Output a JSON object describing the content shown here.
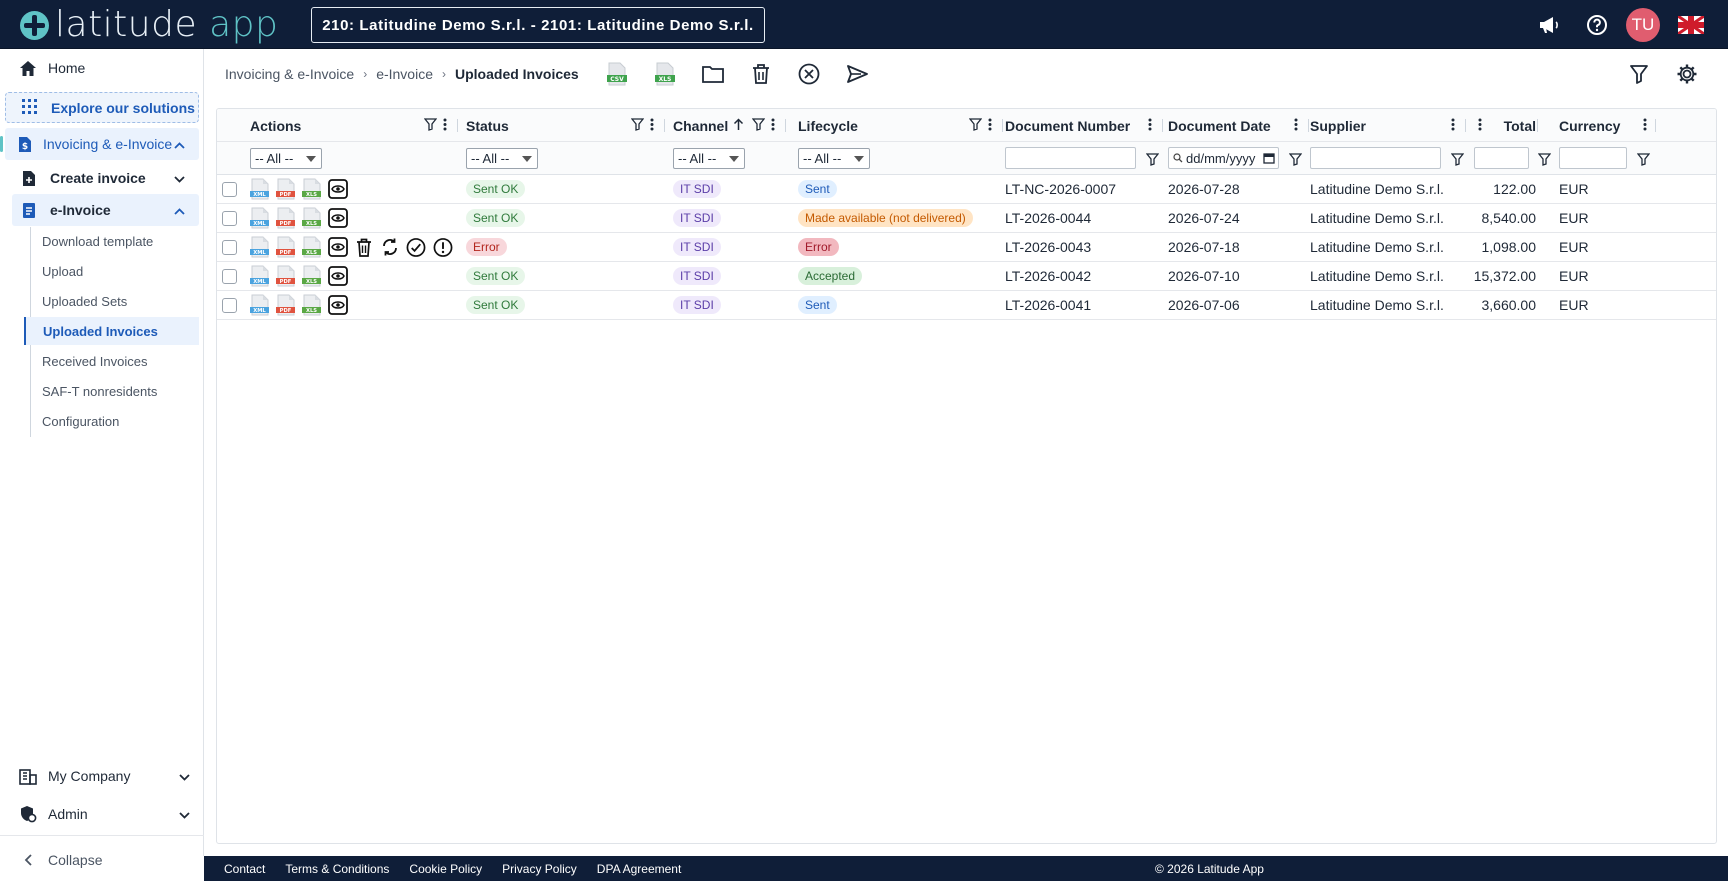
{
  "app": {
    "logo_word": "latitude",
    "logo_app": "app"
  },
  "header": {
    "company_selector": "210: Latitudine Demo S.r.l. - 2101: Latitudine Demo S.r.l.",
    "avatar_initials": "TU",
    "icons": [
      "megaphone-icon",
      "help-icon",
      "avatar",
      "uk-flag-icon"
    ]
  },
  "sidebar": {
    "home": "Home",
    "explore": "Explore our solutions",
    "invoicing": "Invoicing & e-Invoice",
    "create_invoice": "Create invoice",
    "einvoice": "e-Invoice",
    "leaves": [
      "Download template",
      "Upload",
      "Uploaded Sets",
      "Uploaded Invoices",
      "Received Invoices",
      "SAF-T nonresidents",
      "Configuration"
    ],
    "active_leaf": "Uploaded Invoices",
    "my_company": "My Company",
    "admin": "Admin",
    "collapse": "Collapse"
  },
  "breadcrumb": [
    "Invoicing & e-Invoice",
    "e-Invoice",
    "Uploaded Invoices"
  ],
  "toolbar_icons": [
    "csv-export-icon",
    "xls-export-icon",
    "folder-icon",
    "trash-icon",
    "cancel-circle-icon",
    "send-icon",
    "filter-icon",
    "settings-icon"
  ],
  "grid": {
    "columns": [
      "Actions",
      "Status",
      "Channel",
      "Lifecycle",
      "Document Number",
      "Document Date",
      "Supplier",
      "Total",
      "Currency"
    ],
    "filters": {
      "status": "-- All --",
      "channel": "-- All --",
      "lifecycle": "-- All --",
      "actions": "-- All --",
      "date_placeholder": "dd/mm/yyyy"
    },
    "rows": [
      {
        "status": "Sent OK",
        "channel": "IT SDI",
        "lifecycle": "Sent",
        "lifecycle_style": "blue",
        "doc": "LT-NC-2026-0007",
        "date": "2026-07-28",
        "supplier": "Latitudine Demo S.r.l.",
        "total": "122.00",
        "currency": "EUR",
        "extra_actions": false
      },
      {
        "status": "Sent OK",
        "channel": "IT SDI",
        "lifecycle": "Made available (not delivered)",
        "lifecycle_style": "orange",
        "doc": "LT-2026-0044",
        "date": "2026-07-24",
        "supplier": "Latitudine Demo S.r.l.",
        "total": "8,540.00",
        "currency": "EUR",
        "extra_actions": false
      },
      {
        "status": "Error",
        "channel": "IT SDI",
        "lifecycle": "Error",
        "lifecycle_style": "redstrong",
        "doc": "LT-2026-0043",
        "date": "2026-07-18",
        "supplier": "Latitudine Demo S.r.l.",
        "total": "1,098.00",
        "currency": "EUR",
        "extra_actions": true
      },
      {
        "status": "Sent OK",
        "channel": "IT SDI",
        "lifecycle": "Accepted",
        "lifecycle_style": "greenacc",
        "doc": "LT-2026-0042",
        "date": "2026-07-10",
        "supplier": "Latitudine Demo S.r.l.",
        "total": "15,372.00",
        "currency": "EUR",
        "extra_actions": false
      },
      {
        "status": "Sent OK",
        "channel": "IT SDI",
        "lifecycle": "Sent",
        "lifecycle_style": "blue",
        "doc": "LT-2026-0041",
        "date": "2026-07-06",
        "supplier": "Latitudine Demo S.r.l.",
        "total": "3,660.00",
        "currency": "EUR",
        "extra_actions": false
      }
    ]
  },
  "footer": {
    "links": [
      "Contact",
      "Terms & Conditions",
      "Cookie Policy",
      "Privacy Policy",
      "DPA Agreement"
    ],
    "copyright": "© 2026 Latitude App"
  },
  "colors": {
    "navy": "#0f1e38",
    "teal": "#5fc3c6",
    "accent_blue": "#1e5bb8",
    "avatar": "#e05d6f"
  }
}
